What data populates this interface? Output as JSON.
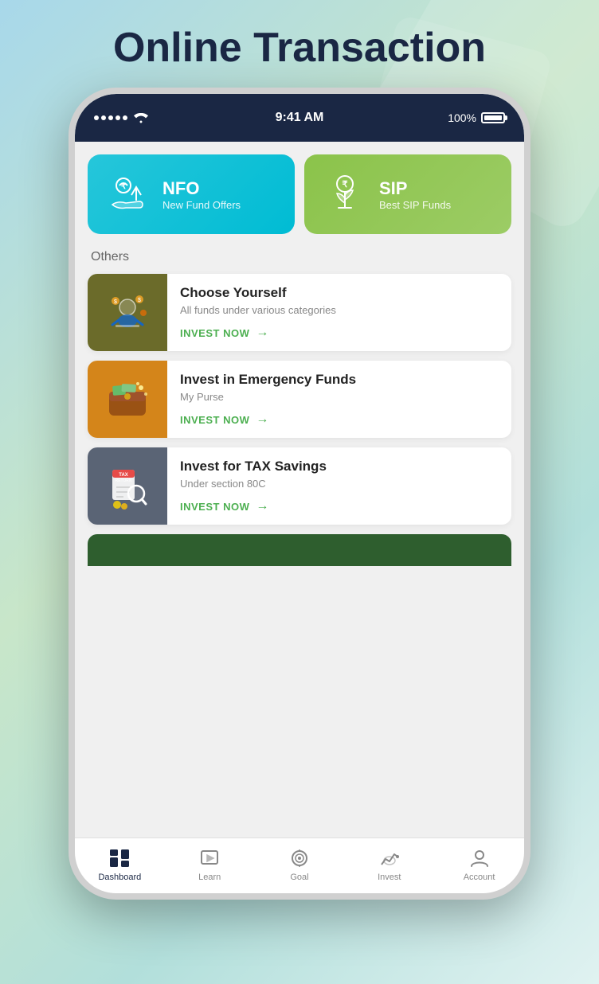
{
  "page": {
    "title": "Online Transaction",
    "background": "gradient-teal"
  },
  "status_bar": {
    "time": "9:41 AM",
    "battery": "100%",
    "signal_dots": 5
  },
  "top_cards": [
    {
      "id": "nfo",
      "title": "NFO",
      "subtitle": "New Fund Offers",
      "color": "teal",
      "icon": "nfo-icon"
    },
    {
      "id": "sip",
      "title": "SIP",
      "subtitle": "Best SIP Funds",
      "color": "green",
      "icon": "sip-icon"
    }
  ],
  "others_label": "Others",
  "list_items": [
    {
      "id": "choose-yourself",
      "title": "Choose Yourself",
      "subtitle": "All funds under various categories",
      "cta": "INVEST NOW",
      "color": "olive",
      "icon": "person-think-icon"
    },
    {
      "id": "emergency-funds",
      "title": "Invest in Emergency Funds",
      "subtitle": "My Purse",
      "cta": "INVEST NOW",
      "color": "amber",
      "icon": "wallet-icon"
    },
    {
      "id": "tax-savings",
      "title": "Invest for TAX Savings",
      "subtitle": "Under section 80C",
      "cta": "INVEST NOW",
      "color": "slate",
      "icon": "tax-return-icon"
    }
  ],
  "bottom_nav": [
    {
      "id": "dashboard",
      "label": "Dashboard",
      "active": true,
      "icon": "dashboard-icon"
    },
    {
      "id": "learn",
      "label": "Learn",
      "active": false,
      "icon": "learn-icon"
    },
    {
      "id": "goal",
      "label": "Goal",
      "active": false,
      "icon": "goal-icon"
    },
    {
      "id": "invest",
      "label": "Invest",
      "active": false,
      "icon": "invest-icon"
    },
    {
      "id": "account",
      "label": "Account",
      "active": false,
      "icon": "account-icon"
    }
  ]
}
